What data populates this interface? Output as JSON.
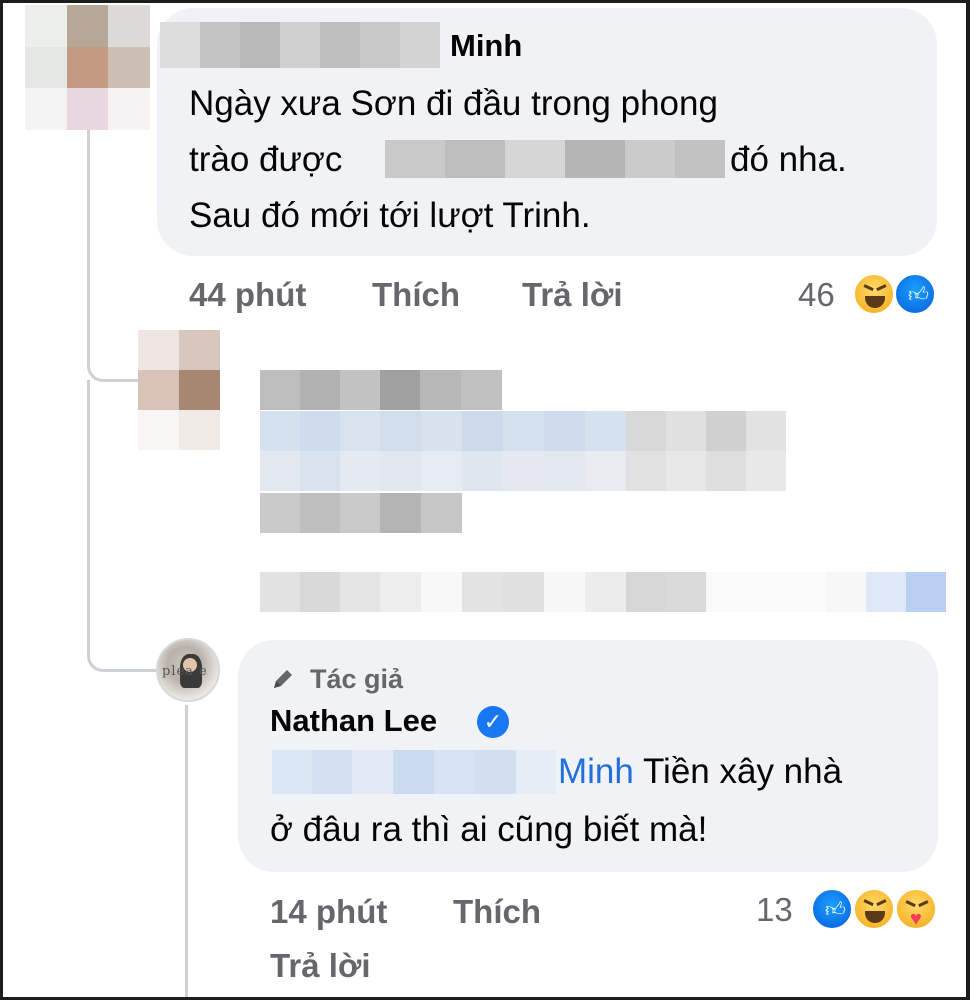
{
  "comment1": {
    "author_suffix": "Minh",
    "text_line1": "Ngày xưa Sơn đi đầu trong phong",
    "text_line2_start": "trào được",
    "text_line2_end": "đó nha.",
    "text_line3": "Sau đó mới tới lượt Trinh.",
    "time": "44 phút",
    "like_label": "Thích",
    "reply_label": "Trả lời",
    "reaction_count": "46",
    "reactions": [
      "haha-icon",
      "like-icon"
    ]
  },
  "reply": {
    "author_badge_icon": "pencil-icon",
    "author_badge": "Tác giả",
    "author_name": "Nathan Lee",
    "verified_icon": "verified-badge-icon",
    "mention_suffix": "Minh",
    "text_line1_rest": " Tiền xây nhà",
    "text_line2": "ở đâu ra thì ai cũng biết mà!",
    "time": "14 phút",
    "like_label": "Thích",
    "reply_label": "Trả lời",
    "reaction_count": "13",
    "reactions": [
      "like-icon",
      "haha-icon",
      "care-icon"
    ]
  },
  "colors": {
    "bubble": "#f0f2f5",
    "meta_text": "#65676b",
    "mention": "#216fdb",
    "like_blue": "#1877f2"
  }
}
